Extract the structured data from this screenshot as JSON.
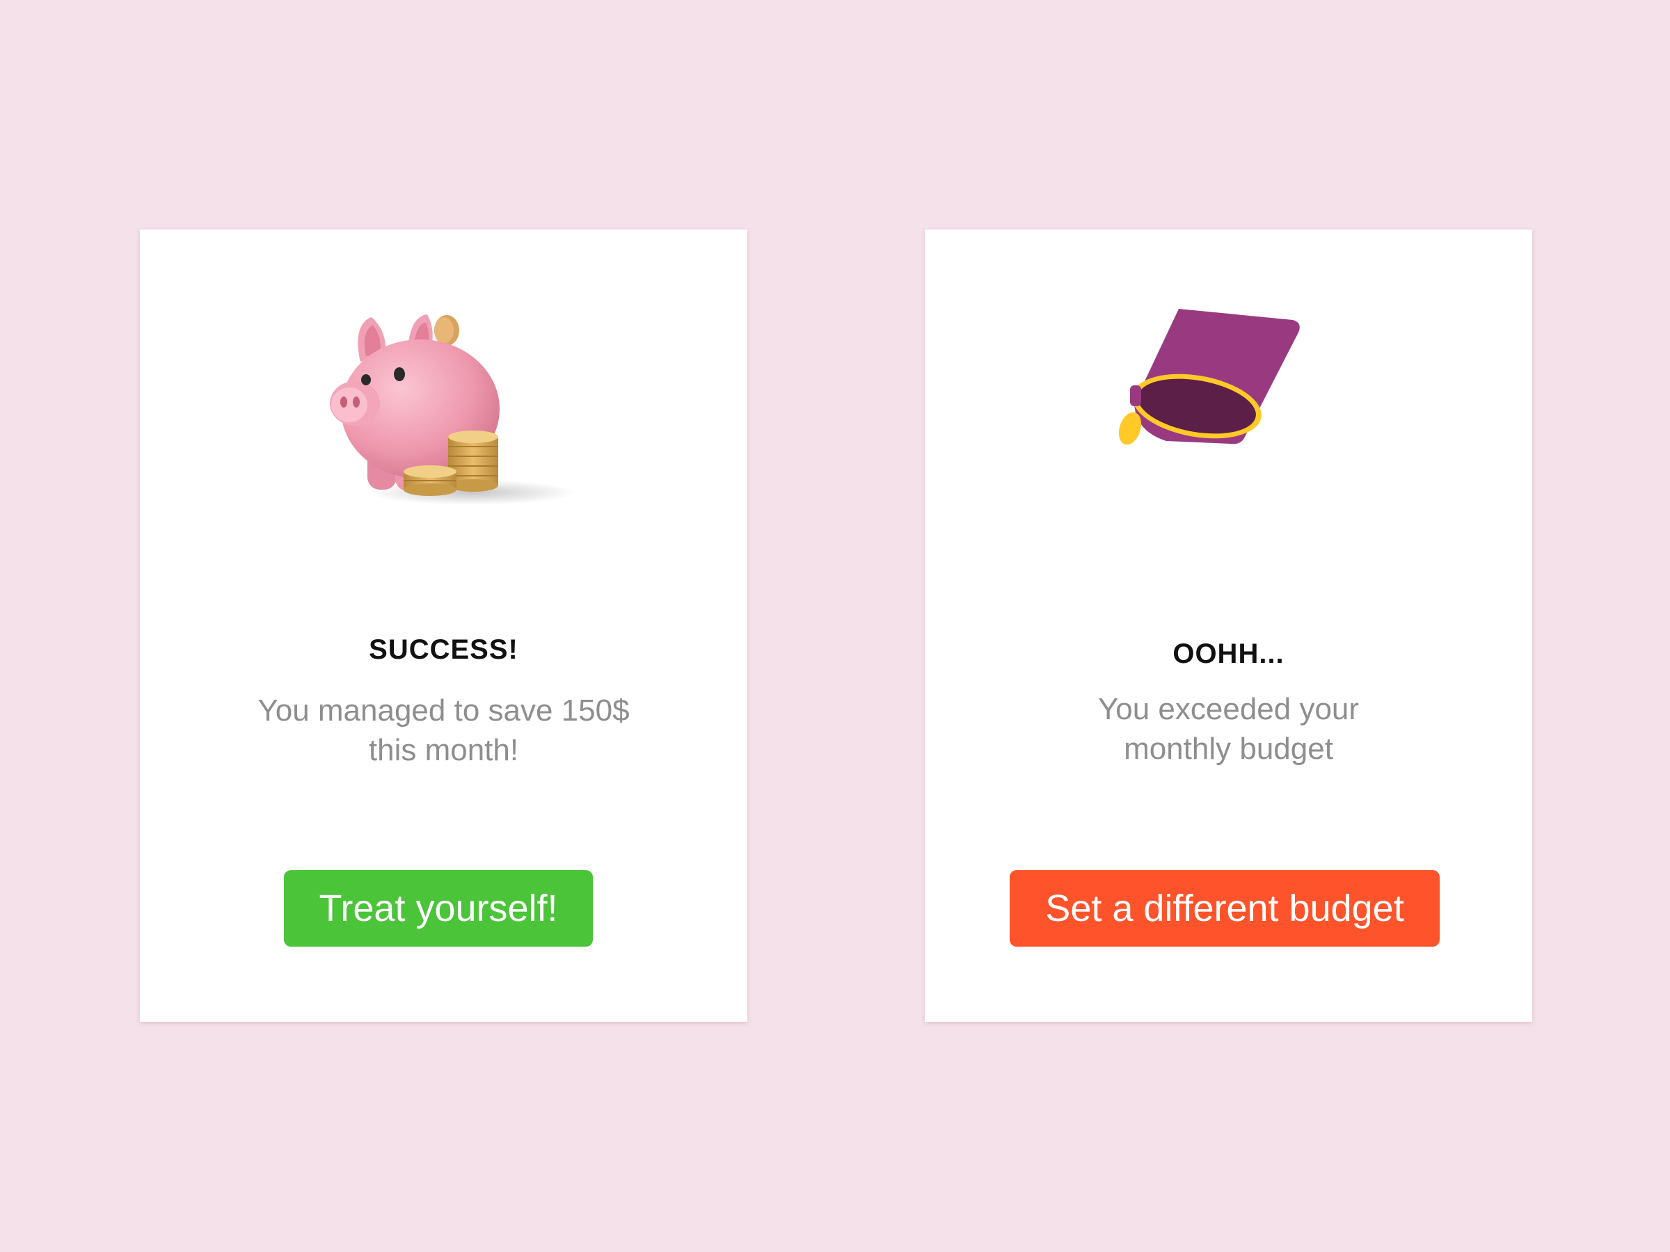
{
  "cards": [
    {
      "illustration": "piggy-bank-with-coins",
      "title": "SUCCESS!",
      "message_lines": [
        "You managed to save 150$",
        "this month!"
      ],
      "button_label": "Treat yourself!",
      "button_color": "#4bc43a"
    },
    {
      "illustration": "empty-purple-wallet",
      "title": "OOHH...",
      "message_lines": [
        "You exceeded your",
        "monthly budget"
      ],
      "button_label": "Set a different budget",
      "button_color": "#ff542b"
    }
  ],
  "colors": {
    "background": "#f5e1ea",
    "card": "#ffffff",
    "title_text": "#111111",
    "message_text": "#8e8e8e",
    "wallet_purple": "#993a80",
    "wallet_zip": "#ffc928"
  }
}
